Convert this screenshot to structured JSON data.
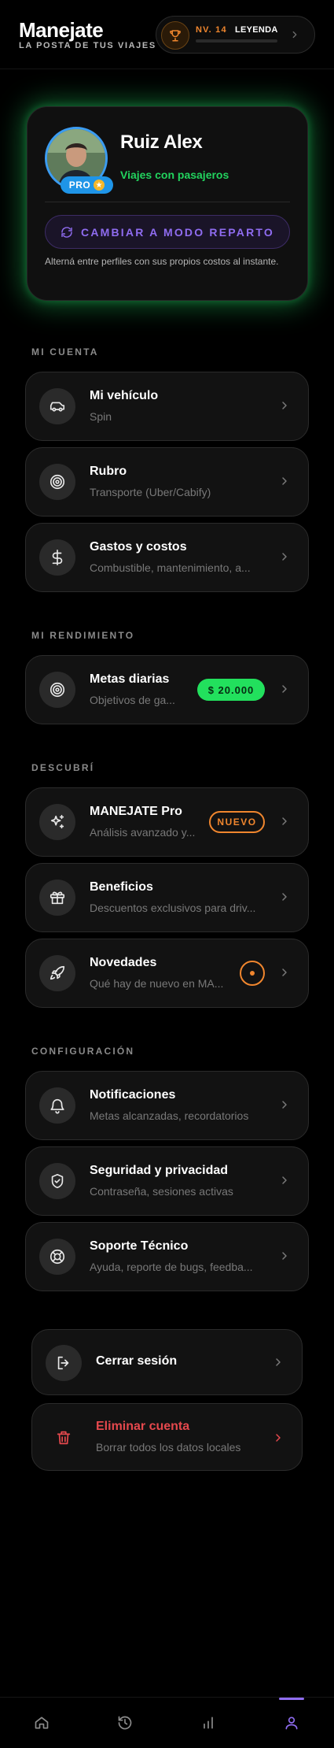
{
  "header": {
    "title": "Manejate",
    "subtitle": "LA POSTA DE TUS VIAJES",
    "level_label": "NV. 14",
    "level_name": "LEYENDA",
    "level_progress": 0.0
  },
  "profile": {
    "name": "Ruiz Alex",
    "role": "Viajes con pasajeros",
    "badge": "PRO",
    "mode_button": "CAMBIAR A MODO REPARTO",
    "hint": "Alterná entre perfiles con sus propios costos al instante."
  },
  "sections": {
    "mi_cuenta": "MI CUENTA",
    "mi_rendimiento": "MI RENDIMIENTO",
    "descubri": "DESCUBRÍ",
    "configuracion": "CONFIGURACIÓN"
  },
  "rows": {
    "vehiculo": {
      "title": "Mi vehículo",
      "subtitle": "Spin"
    },
    "rubro": {
      "title": "Rubro",
      "subtitle": "Transporte (Uber/Cabify)"
    },
    "gastos": {
      "title": "Gastos y costos",
      "subtitle": "Combustible, mantenimiento, a..."
    },
    "metas": {
      "title": "Metas diarias",
      "subtitle": "Objetivos de ga...",
      "badge": "$ 20.000"
    },
    "pro": {
      "title": "MANEJATE Pro",
      "subtitle": "Análisis avanzado y...",
      "badge": "NUEVO"
    },
    "beneficios": {
      "title": "Beneficios",
      "subtitle": "Descuentos exclusivos para driv..."
    },
    "novedades": {
      "title": "Novedades",
      "subtitle": "Qué hay de nuevo en MA..."
    },
    "notificaciones": {
      "title": "Notificaciones",
      "subtitle": "Metas alcanzadas, recordatorios"
    },
    "seguridad": {
      "title": "Seguridad y privacidad",
      "subtitle": "Contraseña, sesiones activas"
    },
    "soporte": {
      "title": "Soporte Técnico",
      "subtitle": "Ayuda, reporte de bugs, feedba..."
    }
  },
  "logout": {
    "label": "Cerrar sesión"
  },
  "delete": {
    "title": "Eliminar cuenta",
    "subtitle": "Borrar todos los datos locales"
  },
  "colors": {
    "accent_purple": "#8f6cf0",
    "accent_green": "#22d35e",
    "accent_orange": "#f0862e",
    "danger": "#e5484d",
    "pro_blue": "#1f95e8"
  },
  "icons": {
    "header": "trophy-icon",
    "vehiculo": "car-icon",
    "rubro": "target-icon",
    "gastos": "dollar-icon",
    "metas": "target-icon",
    "pro": "sparkles-icon",
    "beneficios": "gift-icon",
    "novedades": "rocket-icon",
    "notificaciones": "bell-icon",
    "seguridad": "shield-check-icon",
    "soporte": "lifebuoy-icon",
    "logout": "log-out-icon",
    "delete": "trash-icon",
    "nav": [
      "home-icon",
      "history-icon",
      "stats-icon",
      "user-icon"
    ]
  }
}
